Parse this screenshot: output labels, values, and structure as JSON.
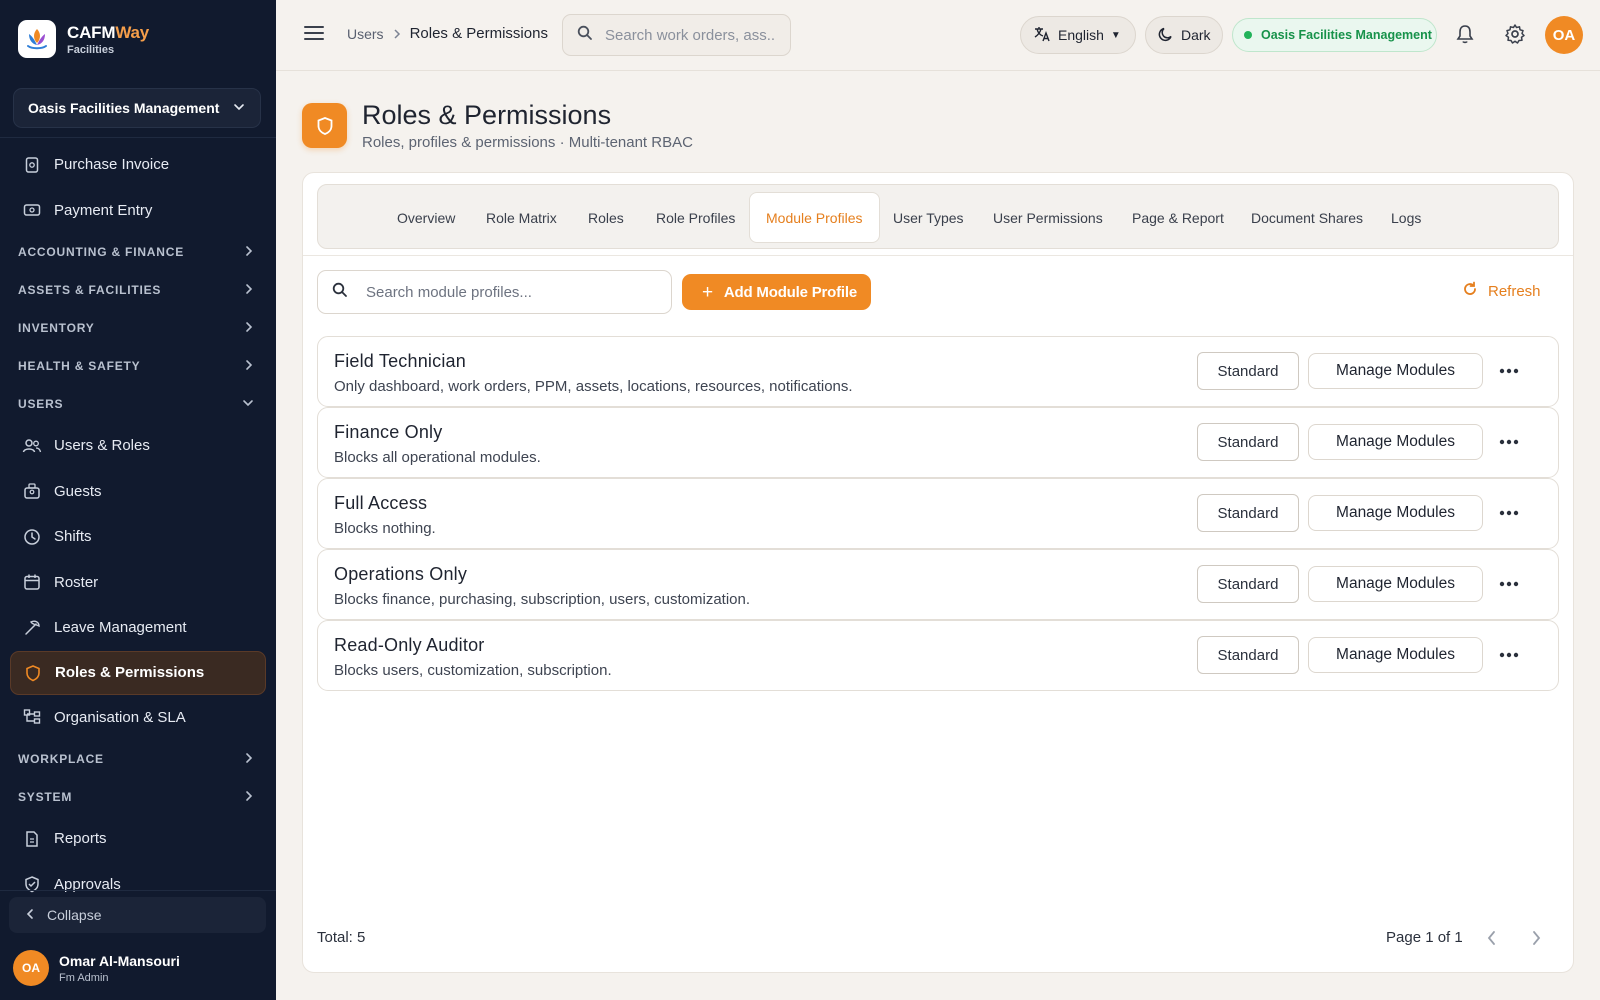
{
  "brand": {
    "name_part1": "CAFM",
    "name_part2": "Way",
    "sub": "Facilities"
  },
  "sidebar": {
    "org": "Oasis Facilities Management",
    "items": [
      {
        "type": "item",
        "label": "Purchase Invoice",
        "icon": "invoice-icon"
      },
      {
        "type": "item",
        "label": "Payment Entry",
        "icon": "payment-icon"
      },
      {
        "type": "group",
        "label": "ACCOUNTING & FINANCE",
        "expanded": false
      },
      {
        "type": "group",
        "label": "ASSETS & FACILITIES",
        "expanded": false
      },
      {
        "type": "group",
        "label": "INVENTORY",
        "expanded": false
      },
      {
        "type": "group",
        "label": "HEALTH & SAFETY",
        "expanded": false
      },
      {
        "type": "group",
        "label": "USERS",
        "expanded": true
      },
      {
        "type": "item",
        "label": "Users & Roles",
        "icon": "users-icon"
      },
      {
        "type": "item",
        "label": "Guests",
        "icon": "guests-icon"
      },
      {
        "type": "item",
        "label": "Shifts",
        "icon": "clock-icon"
      },
      {
        "type": "item",
        "label": "Roster",
        "icon": "calendar-icon"
      },
      {
        "type": "item",
        "label": "Leave Management",
        "icon": "leave-icon"
      },
      {
        "type": "item",
        "label": "Roles & Permissions",
        "icon": "shield-icon",
        "active": true
      },
      {
        "type": "item",
        "label": "Organisation & SLA",
        "icon": "org-chart-icon"
      },
      {
        "type": "group",
        "label": "WORKPLACE",
        "expanded": false
      },
      {
        "type": "group",
        "label": "SYSTEM",
        "expanded": false
      },
      {
        "type": "item",
        "label": "Reports",
        "icon": "reports-icon"
      },
      {
        "type": "item",
        "label": "Approvals",
        "icon": "approval-icon"
      }
    ],
    "collapse_label": "Collapse",
    "user": {
      "initials": "OA",
      "name": "Omar Al-Mansouri",
      "role": "Fm Admin"
    }
  },
  "topbar": {
    "breadcrumb": [
      "Users",
      "Roles & Permissions"
    ],
    "search_placeholder": "Search work orders, ass...",
    "language": "English",
    "theme": "Dark",
    "tenant": "Oasis Facilities Management",
    "avatar_initials": "OA"
  },
  "page": {
    "title": "Roles & Permissions",
    "subtitle": "Roles, profiles & permissions · Multi-tenant RBAC"
  },
  "tabs": [
    "Overview",
    "Role Matrix",
    "Roles",
    "Role Profiles",
    "Module Profiles",
    "User Types",
    "User Permissions",
    "Page & Report",
    "Document Shares",
    "Logs"
  ],
  "active_tab": "Module Profiles",
  "toolbar": {
    "search_placeholder": "Search module profiles...",
    "add_label": "Add Module Profile",
    "refresh_label": "Refresh"
  },
  "profiles": [
    {
      "name": "Field Technician",
      "desc": "Only dashboard, work orders, PPM, assets, locations, resources, notifications.",
      "tag": "Standard",
      "action": "Manage Modules"
    },
    {
      "name": "Finance Only",
      "desc": "Blocks all operational modules.",
      "tag": "Standard",
      "action": "Manage Modules"
    },
    {
      "name": "Full Access",
      "desc": "Blocks nothing.",
      "tag": "Standard",
      "action": "Manage Modules"
    },
    {
      "name": "Operations Only",
      "desc": "Blocks finance, purchasing, subscription, users, customization.",
      "tag": "Standard",
      "action": "Manage Modules"
    },
    {
      "name": "Read-Only Auditor",
      "desc": "Blocks users, customization, subscription.",
      "tag": "Standard",
      "action": "Manage Modules"
    }
  ],
  "footer": {
    "total": "Total: 5",
    "page_info": "Page 1 of 1"
  },
  "colors": {
    "accent": "#f08a24",
    "sidebar_bg": "#111a2e",
    "success": "#17924a"
  }
}
